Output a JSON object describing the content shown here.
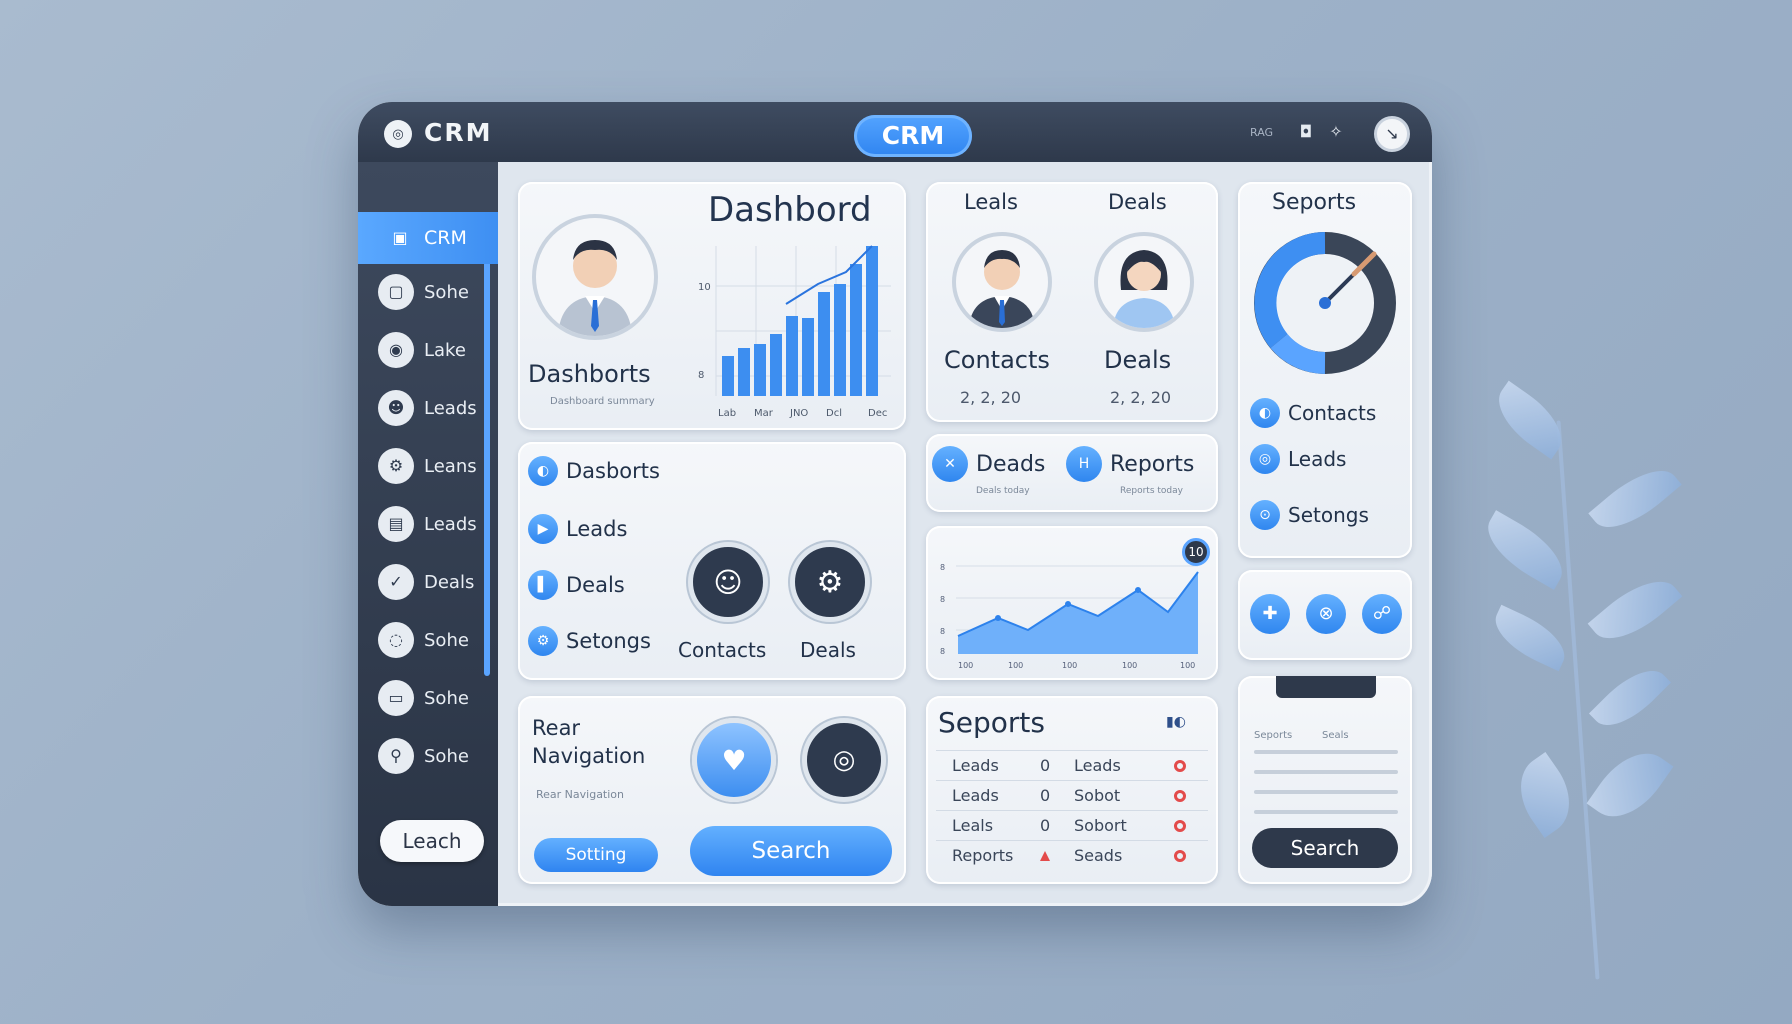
{
  "topbar": {
    "brand": "CRM",
    "center_pill": "CRM",
    "tiny_text": "RAG"
  },
  "sidebar": {
    "items": [
      {
        "label": "CRM",
        "icon": "chart-icon"
      },
      {
        "label": "Sohe",
        "icon": "box-icon"
      },
      {
        "label": "Lake",
        "icon": "settings-icon"
      },
      {
        "label": "Leads",
        "icon": "people-icon"
      },
      {
        "label": "Leans",
        "icon": "gear-icon"
      },
      {
        "label": "Leads",
        "icon": "folder-icon"
      },
      {
        "label": "Deals",
        "icon": "check-icon"
      },
      {
        "label": "Sohe",
        "icon": "chat-icon"
      },
      {
        "label": "Sohe",
        "icon": "window-icon"
      },
      {
        "label": "Sohe",
        "icon": "person-icon"
      }
    ],
    "bottom_button": "Leach"
  },
  "dashboard_card": {
    "title": "Dashbord",
    "profile_label": "Dashborts",
    "profile_sub": "Dashboard summary",
    "chart_xticks": [
      "Lab",
      "Mar",
      "JNO",
      "Dcl",
      "Dec"
    ],
    "chart_yticks": [
      "10",
      "8"
    ]
  },
  "nav_card": {
    "items": [
      "Dasborts",
      "Leads",
      "Deals",
      "Setongs"
    ],
    "buttons": [
      "Contacts",
      "Deals"
    ]
  },
  "rear_card": {
    "title_line1": "Rear",
    "title_line2": "Navigation",
    "sub": "Rear Navigation",
    "button": "Sotting",
    "search": "Search"
  },
  "leals_card": {
    "labels": [
      "Leals",
      "Deals"
    ],
    "names": [
      "Contacts",
      "Deals"
    ],
    "values": [
      "2, 2, 20",
      "2, 2, 20"
    ]
  },
  "deads_card": {
    "items": [
      {
        "label": "Deads",
        "sub": "Deals today"
      },
      {
        "label": "Reports",
        "sub": "Reports today"
      }
    ]
  },
  "area_card": {
    "badge": "10",
    "xticks": [
      "100",
      "100",
      "100",
      "100",
      "100"
    ],
    "yticks": [
      "8",
      "8",
      "8",
      "8"
    ]
  },
  "seports_table": {
    "title": "Seports",
    "rows": [
      [
        "Leads",
        "0",
        "Leads"
      ],
      [
        "Leads",
        "0",
        "Sobot"
      ],
      [
        "Leals",
        "0",
        "Sobort"
      ],
      [
        "Reports",
        "",
        "Seads"
      ]
    ]
  },
  "right_card": {
    "title": "Seports",
    "items": [
      "Contacts",
      "Leads",
      "Setongs"
    ]
  },
  "form_card": {
    "label_a": "Seports",
    "label_b": "Seals",
    "search_button": "Search"
  },
  "colors": {
    "accent": "#2f84f0",
    "dark": "#2e394b",
    "background": "#a3b7cc"
  }
}
